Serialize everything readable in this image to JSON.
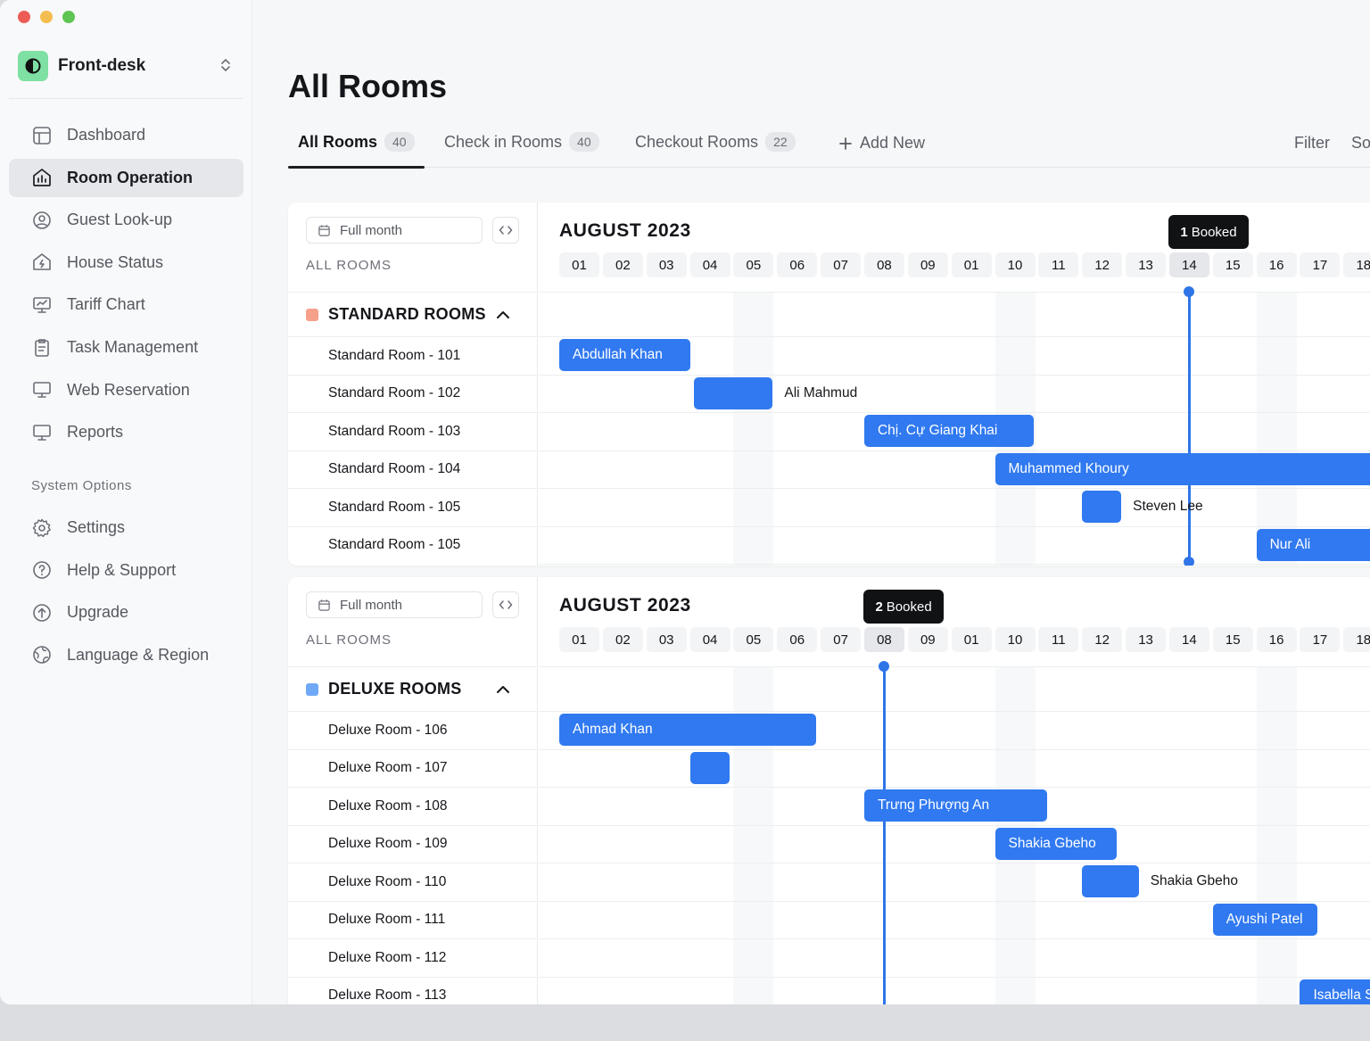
{
  "window": {
    "traffic_colors": [
      "#ee5c56",
      "#f4bd4f",
      "#5fc454"
    ]
  },
  "workspace": {
    "name": "Front-desk"
  },
  "sidebar": {
    "items": [
      {
        "label": "Dashboard",
        "icon": "layout-icon"
      },
      {
        "label": "Room Operation",
        "icon": "home-chart-icon",
        "active": true
      },
      {
        "label": "Guest Look-up",
        "icon": "user-circle-icon"
      },
      {
        "label": "House Status",
        "icon": "house-bolt-icon"
      },
      {
        "label": "Tariff Chart",
        "icon": "presentation-chart-icon"
      },
      {
        "label": "Task Management",
        "icon": "clipboard-icon"
      },
      {
        "label": "Web Reservation",
        "icon": "monitor-icon"
      },
      {
        "label": "Reports",
        "icon": "monitor-icon"
      }
    ],
    "section_label": "System Options",
    "system_items": [
      {
        "label": "Settings",
        "icon": "gear-icon"
      },
      {
        "label": "Help & Support",
        "icon": "question-icon"
      },
      {
        "label": "Upgrade",
        "icon": "arrow-up-circle-icon"
      },
      {
        "label": "Language & Region",
        "icon": "globe-icon"
      }
    ]
  },
  "page": {
    "title": "All Rooms"
  },
  "tabs": [
    {
      "label": "All Rooms",
      "count": "40",
      "active": true
    },
    {
      "label": "Check in Rooms",
      "count": "40"
    },
    {
      "label": "Checkout Rooms",
      "count": "22"
    }
  ],
  "add_new_label": "Add New",
  "filter_label": "Filter",
  "sort_label": "So",
  "calendar_common": {
    "range_label": "Full month",
    "all_rooms_label": "ALL ROOMS",
    "month": "AUGUST 2023",
    "days": [
      "01",
      "02",
      "03",
      "04",
      "05",
      "06",
      "07",
      "08",
      "09",
      "01",
      "10",
      "11",
      "12",
      "13",
      "14",
      "15",
      "16",
      "17",
      "18"
    ]
  },
  "panels": [
    {
      "group": "STANDARD ROOMS",
      "group_color": "#f6a08a",
      "booked_count": "1",
      "booked_text": "Booked",
      "marker_day_index": 14,
      "rooms": [
        "Standard Room - 101",
        "Standard Room - 102",
        "Standard Room - 103",
        "Standard Room - 104",
        "Standard Room - 105",
        "Standard Room - 105"
      ],
      "bookings": [
        {
          "guest": "Abdullah Khan",
          "row": 0,
          "start": 0,
          "end": 3.0,
          "label_inside": true
        },
        {
          "guest": "Ali Mahmud",
          "row": 1,
          "start": 3.1,
          "end": 4.9,
          "label_inside": false
        },
        {
          "guest": "Chị. Cự Giang Khai",
          "row": 2,
          "start": 7.0,
          "end": 10.9,
          "label_inside": true
        },
        {
          "guest": "Muhammed Khoury",
          "row": 3,
          "start": 10.0,
          "end": 19.5,
          "label_inside": true
        },
        {
          "guest": "Steven Lee",
          "row": 4,
          "start": 12.0,
          "end": 12.9,
          "label_inside": false
        },
        {
          "guest": "Nur Ali",
          "row": 5,
          "start": 16.0,
          "end": 19.5,
          "label_inside": true
        }
      ]
    },
    {
      "group": "DELUXE ROOMS",
      "group_color": "#6fa9f5",
      "booked_count": "2",
      "booked_text": "Booked",
      "marker_day_index": 7,
      "rooms": [
        "Deluxe Room - 106",
        "Deluxe Room - 107",
        "Deluxe Room - 108",
        "Deluxe Room - 109",
        "Deluxe Room - 110",
        "Deluxe Room - 111",
        "Deluxe Room - 112",
        "Deluxe Room - 113"
      ],
      "bookings": [
        {
          "guest": "Ahmad Khan",
          "row": 0,
          "start": 0,
          "end": 5.9,
          "label_inside": true
        },
        {
          "guest": "",
          "row": 1,
          "start": 3.0,
          "end": 3.9,
          "label_inside": false
        },
        {
          "guest": "Trưng Phượng An",
          "row": 2,
          "start": 7.0,
          "end": 11.2,
          "label_inside": true
        },
        {
          "guest": "Shakia Gbeho",
          "row": 3,
          "start": 10.0,
          "end": 12.8,
          "label_inside": true
        },
        {
          "guest": "Shakia Gbeho",
          "row": 4,
          "start": 12.0,
          "end": 13.3,
          "label_inside": false
        },
        {
          "guest": "Ayushi Patel",
          "row": 5,
          "start": 15.0,
          "end": 17.4,
          "label_inside": true
        },
        {
          "guest": "Isabella S",
          "row": 7,
          "start": 17.0,
          "end": 19.5,
          "label_inside": true
        }
      ]
    }
  ]
}
